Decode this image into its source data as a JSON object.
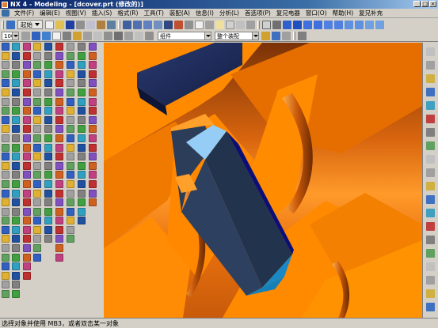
{
  "window": {
    "title": "NX 4 - Modeling - [dcover.prt (修改的)]",
    "buttons": {
      "minimize": "_",
      "maximize": "□",
      "close": "×"
    }
  },
  "menubar": {
    "items": [
      "文件(F)",
      "编辑(E)",
      "视图(V)",
      "插入(S)",
      "格式(R)",
      "工具(T)",
      "装配(A)",
      "信息(I)",
      "分析(L)",
      "首选项(P)",
      "复兄电器",
      "窗口(O)",
      "帮助(H)",
      "复兄补充"
    ]
  },
  "toolbar1": {
    "start_label": "起始"
  },
  "toolbar2": {
    "zoom_value": "100",
    "filter_value": "组件",
    "scope_value": "整个装配"
  },
  "statusbar": {
    "prompt": "选择对象并使用 MB3，或者双击某一对象"
  },
  "colors": {
    "title_bar": "#0a246a",
    "viewport_bg": "#e8730f",
    "part_orange": "#ff8a00",
    "block_face": "#2a3a55",
    "block_top": "#8ec8f0",
    "dark_plate": "#1c2c5c"
  }
}
